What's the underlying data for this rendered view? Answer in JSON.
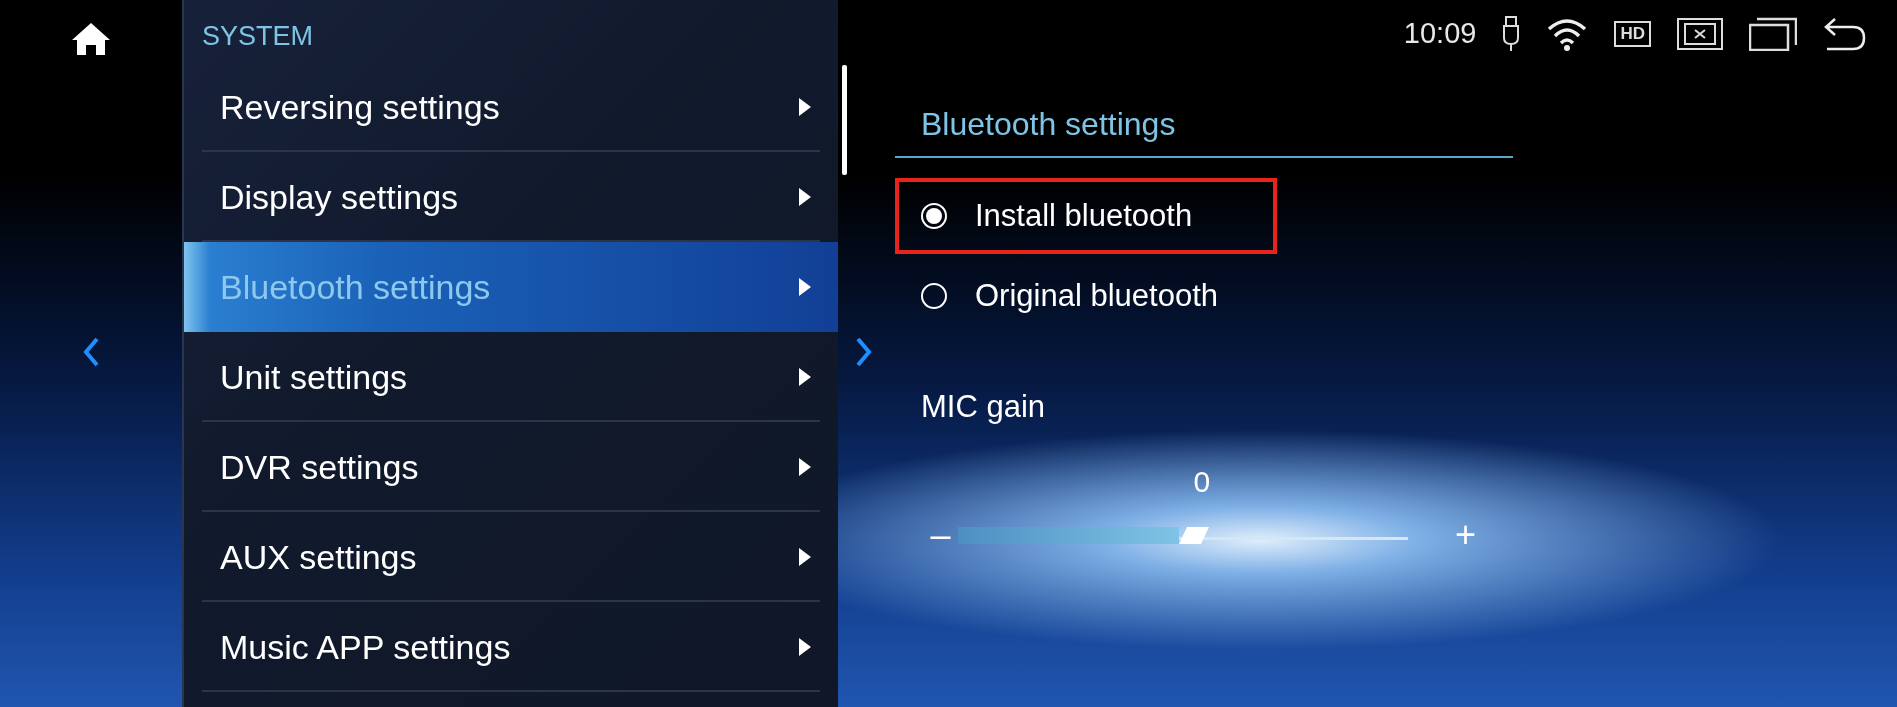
{
  "status_bar": {
    "time": "10:09",
    "hd_label": "HD"
  },
  "menu": {
    "title": "SYSTEM",
    "items": [
      {
        "label": "Reversing settings",
        "selected": false
      },
      {
        "label": "Display settings",
        "selected": false
      },
      {
        "label": "Bluetooth settings",
        "selected": true
      },
      {
        "label": "Unit settings",
        "selected": false
      },
      {
        "label": "DVR settings",
        "selected": false
      },
      {
        "label": "AUX settings",
        "selected": false
      },
      {
        "label": "Music APP settings",
        "selected": false
      }
    ]
  },
  "panel": {
    "title": "Bluetooth settings",
    "options": [
      {
        "label": "Install bluetooth",
        "selected": true,
        "highlighted": true
      },
      {
        "label": "Original bluetooth",
        "selected": false,
        "highlighted": false
      }
    ],
    "mic_gain": {
      "label": "MIC gain",
      "reading": "0",
      "level": 0.49,
      "minus": "–",
      "plus": "+"
    }
  }
}
